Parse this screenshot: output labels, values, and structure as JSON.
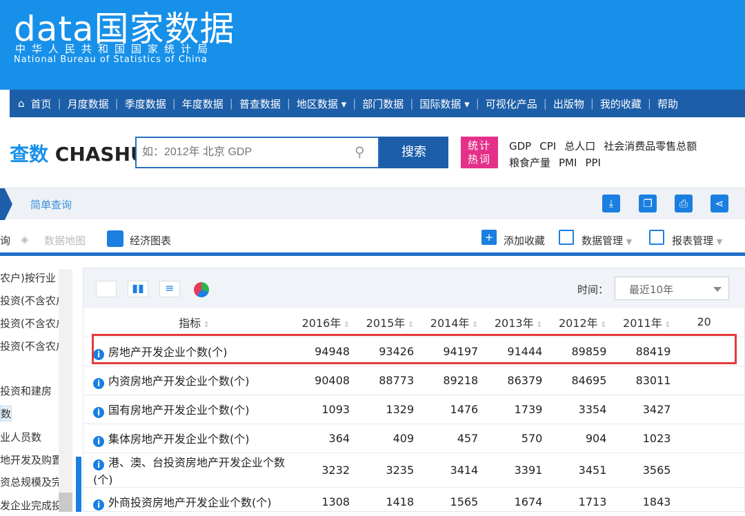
{
  "header": {
    "logo_main": "data国家数据",
    "logo_cn": "中华人民共和国国家统计局",
    "logo_en": "National Bureau of Statistics of China"
  },
  "nav": [
    "首页",
    "月度数据",
    "季度数据",
    "年度数据",
    "普查数据",
    "地区数据 ▾",
    "部门数据",
    "国际数据 ▾",
    "可视化产品",
    "出版物",
    "我的收藏",
    "帮助"
  ],
  "search": {
    "brand_cn": "查数",
    "brand_en": "CHASHU",
    "placeholder": "如：2012年 北京 GDP",
    "button": "搜索",
    "hot_label": "统计热词",
    "hot_links": [
      "GDP",
      "CPI",
      "总人口",
      "社会消费品零售总额",
      "粮食产量",
      "PMI",
      "PPI"
    ]
  },
  "breadcrumb": {
    "label": "简单查询"
  },
  "toolbar": {
    "left_cut": "询",
    "data_map": "数据地图",
    "econ_chart": "经济图表",
    "add_fav": "添加收藏",
    "data_mgmt": "数据管理",
    "report_mgmt": "报表管理"
  },
  "sidebar": [
    "农户)按行业 ▲",
    "投资(不含农户",
    "投资(不含农户",
    "投资(不含农户",
    "投资和建房",
    "数",
    "业人员数",
    "地开发及购置",
    "资总规模及完",
    "发企业完成投"
  ],
  "filter": {
    "time_label": "时间：",
    "time_value": "最近10年"
  },
  "table": {
    "headers": [
      "指标",
      "2016年",
      "2015年",
      "2014年",
      "2013年",
      "2012年",
      "2011年",
      "20"
    ],
    "rows": [
      {
        "name": "房地产开发企业个数(个)",
        "values": [
          "94948",
          "93426",
          "94197",
          "91444",
          "89859",
          "88419"
        ]
      },
      {
        "name": "内资房地产开发企业个数(个)",
        "values": [
          "90408",
          "88773",
          "89218",
          "86379",
          "84695",
          "83011"
        ]
      },
      {
        "name": "国有房地产开发企业个数(个)",
        "values": [
          "1093",
          "1329",
          "1476",
          "1739",
          "3354",
          "3427"
        ]
      },
      {
        "name": "集体房地产开发企业个数(个)",
        "values": [
          "364",
          "409",
          "457",
          "570",
          "904",
          "1023"
        ]
      },
      {
        "name": "港、澳、台投资房地产开发企业个数(个)",
        "values": [
          "3232",
          "3235",
          "3414",
          "3391",
          "3451",
          "3565"
        ]
      },
      {
        "name": "外商投资房地产开发企业个数(个)",
        "values": [
          "1308",
          "1418",
          "1565",
          "1674",
          "1713",
          "1843"
        ]
      }
    ]
  },
  "colors": {
    "header": "#1790ea",
    "nav": "#1c5ea8",
    "highlight": "#e23a3a"
  }
}
